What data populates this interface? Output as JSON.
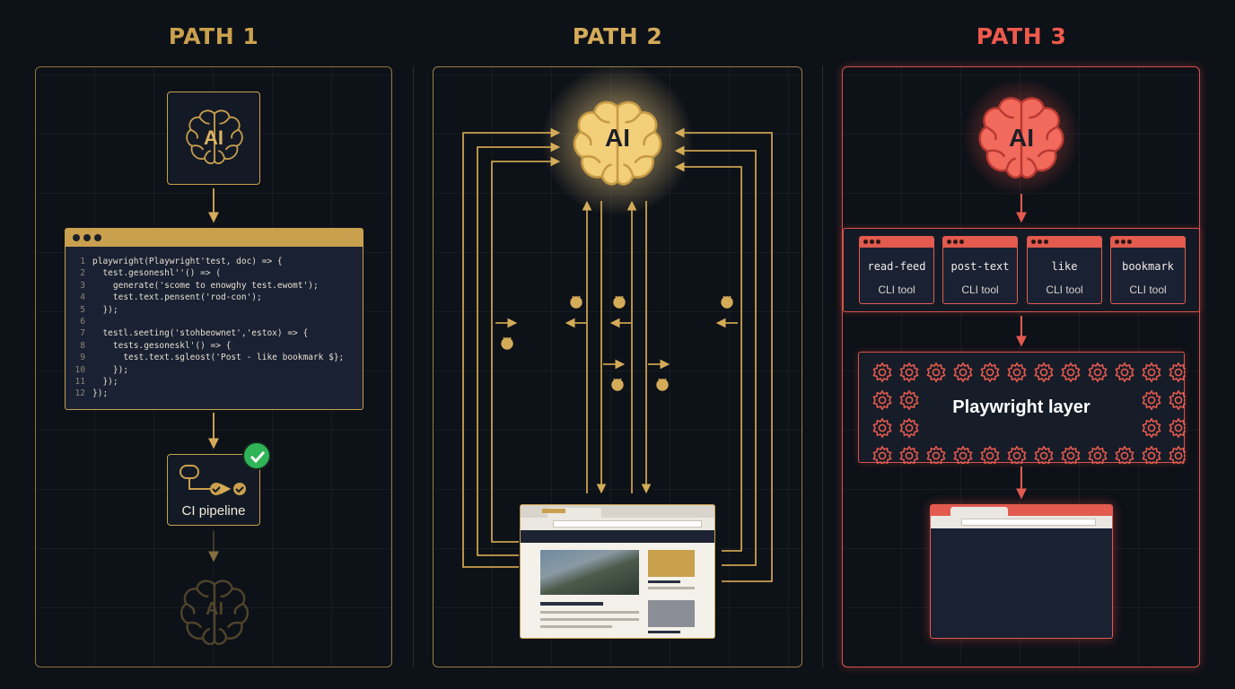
{
  "paths": [
    {
      "title": "PATH 1",
      "color": "#c9a04d"
    },
    {
      "title": "PATH 2",
      "color": "#d4ab58"
    },
    {
      "title": "PATH 3",
      "color": "#ef5a4c"
    }
  ],
  "ai_label": "AI",
  "path1": {
    "code_lines": [
      {
        "n": "1",
        "text": "playwright(Playwright'test, doc) => {"
      },
      {
        "n": "2",
        "text": "  test.gesoneshl''() => ("
      },
      {
        "n": "3",
        "text": "    generate('scome to enowghy test.ewomt');"
      },
      {
        "n": "4",
        "text": "    test.text.pensent('rod-con');"
      },
      {
        "n": "5",
        "text": "  });"
      },
      {
        "n": "6",
        "text": ""
      },
      {
        "n": "7",
        "text": "  testl.seeting('stohbeownet','estox) => {"
      },
      {
        "n": "8",
        "text": "    tests.gesoneskl'() => {"
      },
      {
        "n": "9",
        "text": "      test.text.sgleost('Post - like bookmark $};"
      },
      {
        "n": "10",
        "text": "    });"
      },
      {
        "n": "11",
        "text": "  });"
      },
      {
        "n": "12",
        "text": "});"
      }
    ],
    "ci_label": "CI pipeline"
  },
  "path3": {
    "tools": [
      {
        "name": "read-feed",
        "sub": "CLI tool"
      },
      {
        "name": "post-text",
        "sub": "CLI tool"
      },
      {
        "name": "like",
        "sub": "CLI tool"
      },
      {
        "name": "bookmark",
        "sub": "CLI tool"
      }
    ],
    "layer_label": "Playwright layer"
  },
  "icons": [
    "brain-icon",
    "arrow-icon",
    "check-icon",
    "pipeline-icon",
    "gear-icon",
    "bug-icon",
    "browser-icon"
  ]
}
